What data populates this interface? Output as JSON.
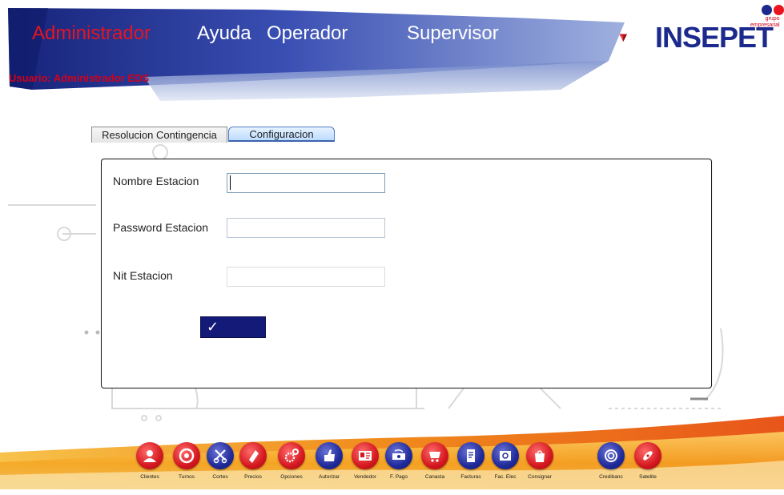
{
  "header": {
    "menu": [
      {
        "label": "Administrador",
        "active": true
      },
      {
        "label": "Ayuda",
        "active": false
      },
      {
        "label": "Operador",
        "active": false
      },
      {
        "label": "Supervisor",
        "active": false
      }
    ],
    "user_label": "Usuario: Administrador EDS",
    "logo": {
      "brand": "INSEPET",
      "tag_line1": "grupo",
      "tag_line2": "empresarial"
    }
  },
  "colors": {
    "accent_red": "#e8141e",
    "header_blue": "#1b2a8c",
    "button_navy": "#141a78"
  },
  "tabs": [
    {
      "label": "Resolucion Contingencia",
      "selected": false
    },
    {
      "label": "Configuracion",
      "selected": true
    }
  ],
  "form": {
    "fields": [
      {
        "label": "Nombre Estacion",
        "value": "",
        "placeholder": ""
      },
      {
        "label": "Password Estacion",
        "value": "",
        "placeholder": ""
      },
      {
        "label": "Nit Estacion",
        "value": "",
        "placeholder": ""
      }
    ],
    "submit_label": "✓"
  },
  "dock": [
    {
      "label": "Clientes",
      "icon": "users-icon",
      "color": "red"
    },
    {
      "label": "Turnos",
      "icon": "phone-icon",
      "color": "red"
    },
    {
      "label": "Cortes",
      "icon": "scissors-icon",
      "color": "blue"
    },
    {
      "label": "Precios",
      "icon": "tag-icon",
      "color": "red"
    },
    {
      "label": "Opciones",
      "icon": "gears-icon",
      "color": "red"
    },
    {
      "label": "Autorizar",
      "icon": "thumbs-up-icon",
      "color": "blue"
    },
    {
      "label": "Vendedor",
      "icon": "id-card-icon",
      "color": "red"
    },
    {
      "label": "F. Pago",
      "icon": "cash-icon",
      "color": "blue"
    },
    {
      "label": "Canasta",
      "icon": "cart-icon",
      "color": "red"
    },
    {
      "label": "Facturas",
      "icon": "invoice-icon",
      "color": "blue"
    },
    {
      "label": "Fac. Elec",
      "icon": "email-icon",
      "color": "blue"
    },
    {
      "label": "Consignar",
      "icon": "bag-icon",
      "color": "red"
    },
    {
      "label": "Credibanc",
      "icon": "card-circle-icon",
      "color": "blue"
    },
    {
      "label": "Satelite",
      "icon": "satellite-icon",
      "color": "red"
    }
  ]
}
